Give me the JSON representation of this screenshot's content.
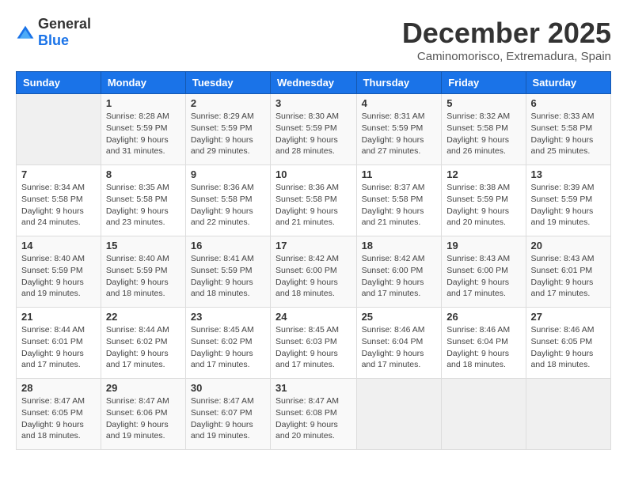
{
  "logo": {
    "general": "General",
    "blue": "Blue"
  },
  "title": "December 2025",
  "subtitle": "Caminomorisco, Extremadura, Spain",
  "headers": [
    "Sunday",
    "Monday",
    "Tuesday",
    "Wednesday",
    "Thursday",
    "Friday",
    "Saturday"
  ],
  "weeks": [
    [
      {
        "day": "",
        "info": ""
      },
      {
        "day": "1",
        "info": "Sunrise: 8:28 AM\nSunset: 5:59 PM\nDaylight: 9 hours\nand 31 minutes."
      },
      {
        "day": "2",
        "info": "Sunrise: 8:29 AM\nSunset: 5:59 PM\nDaylight: 9 hours\nand 29 minutes."
      },
      {
        "day": "3",
        "info": "Sunrise: 8:30 AM\nSunset: 5:59 PM\nDaylight: 9 hours\nand 28 minutes."
      },
      {
        "day": "4",
        "info": "Sunrise: 8:31 AM\nSunset: 5:59 PM\nDaylight: 9 hours\nand 27 minutes."
      },
      {
        "day": "5",
        "info": "Sunrise: 8:32 AM\nSunset: 5:58 PM\nDaylight: 9 hours\nand 26 minutes."
      },
      {
        "day": "6",
        "info": "Sunrise: 8:33 AM\nSunset: 5:58 PM\nDaylight: 9 hours\nand 25 minutes."
      }
    ],
    [
      {
        "day": "7",
        "info": "Sunrise: 8:34 AM\nSunset: 5:58 PM\nDaylight: 9 hours\nand 24 minutes."
      },
      {
        "day": "8",
        "info": "Sunrise: 8:35 AM\nSunset: 5:58 PM\nDaylight: 9 hours\nand 23 minutes."
      },
      {
        "day": "9",
        "info": "Sunrise: 8:36 AM\nSunset: 5:58 PM\nDaylight: 9 hours\nand 22 minutes."
      },
      {
        "day": "10",
        "info": "Sunrise: 8:36 AM\nSunset: 5:58 PM\nDaylight: 9 hours\nand 21 minutes."
      },
      {
        "day": "11",
        "info": "Sunrise: 8:37 AM\nSunset: 5:58 PM\nDaylight: 9 hours\nand 21 minutes."
      },
      {
        "day": "12",
        "info": "Sunrise: 8:38 AM\nSunset: 5:59 PM\nDaylight: 9 hours\nand 20 minutes."
      },
      {
        "day": "13",
        "info": "Sunrise: 8:39 AM\nSunset: 5:59 PM\nDaylight: 9 hours\nand 19 minutes."
      }
    ],
    [
      {
        "day": "14",
        "info": "Sunrise: 8:40 AM\nSunset: 5:59 PM\nDaylight: 9 hours\nand 19 minutes."
      },
      {
        "day": "15",
        "info": "Sunrise: 8:40 AM\nSunset: 5:59 PM\nDaylight: 9 hours\nand 18 minutes."
      },
      {
        "day": "16",
        "info": "Sunrise: 8:41 AM\nSunset: 5:59 PM\nDaylight: 9 hours\nand 18 minutes."
      },
      {
        "day": "17",
        "info": "Sunrise: 8:42 AM\nSunset: 6:00 PM\nDaylight: 9 hours\nand 18 minutes."
      },
      {
        "day": "18",
        "info": "Sunrise: 8:42 AM\nSunset: 6:00 PM\nDaylight: 9 hours\nand 17 minutes."
      },
      {
        "day": "19",
        "info": "Sunrise: 8:43 AM\nSunset: 6:00 PM\nDaylight: 9 hours\nand 17 minutes."
      },
      {
        "day": "20",
        "info": "Sunrise: 8:43 AM\nSunset: 6:01 PM\nDaylight: 9 hours\nand 17 minutes."
      }
    ],
    [
      {
        "day": "21",
        "info": "Sunrise: 8:44 AM\nSunset: 6:01 PM\nDaylight: 9 hours\nand 17 minutes."
      },
      {
        "day": "22",
        "info": "Sunrise: 8:44 AM\nSunset: 6:02 PM\nDaylight: 9 hours\nand 17 minutes."
      },
      {
        "day": "23",
        "info": "Sunrise: 8:45 AM\nSunset: 6:02 PM\nDaylight: 9 hours\nand 17 minutes."
      },
      {
        "day": "24",
        "info": "Sunrise: 8:45 AM\nSunset: 6:03 PM\nDaylight: 9 hours\nand 17 minutes."
      },
      {
        "day": "25",
        "info": "Sunrise: 8:46 AM\nSunset: 6:04 PM\nDaylight: 9 hours\nand 17 minutes."
      },
      {
        "day": "26",
        "info": "Sunrise: 8:46 AM\nSunset: 6:04 PM\nDaylight: 9 hours\nand 18 minutes."
      },
      {
        "day": "27",
        "info": "Sunrise: 8:46 AM\nSunset: 6:05 PM\nDaylight: 9 hours\nand 18 minutes."
      }
    ],
    [
      {
        "day": "28",
        "info": "Sunrise: 8:47 AM\nSunset: 6:05 PM\nDaylight: 9 hours\nand 18 minutes."
      },
      {
        "day": "29",
        "info": "Sunrise: 8:47 AM\nSunset: 6:06 PM\nDaylight: 9 hours\nand 19 minutes."
      },
      {
        "day": "30",
        "info": "Sunrise: 8:47 AM\nSunset: 6:07 PM\nDaylight: 9 hours\nand 19 minutes."
      },
      {
        "day": "31",
        "info": "Sunrise: 8:47 AM\nSunset: 6:08 PM\nDaylight: 9 hours\nand 20 minutes."
      },
      {
        "day": "",
        "info": ""
      },
      {
        "day": "",
        "info": ""
      },
      {
        "day": "",
        "info": ""
      }
    ]
  ]
}
